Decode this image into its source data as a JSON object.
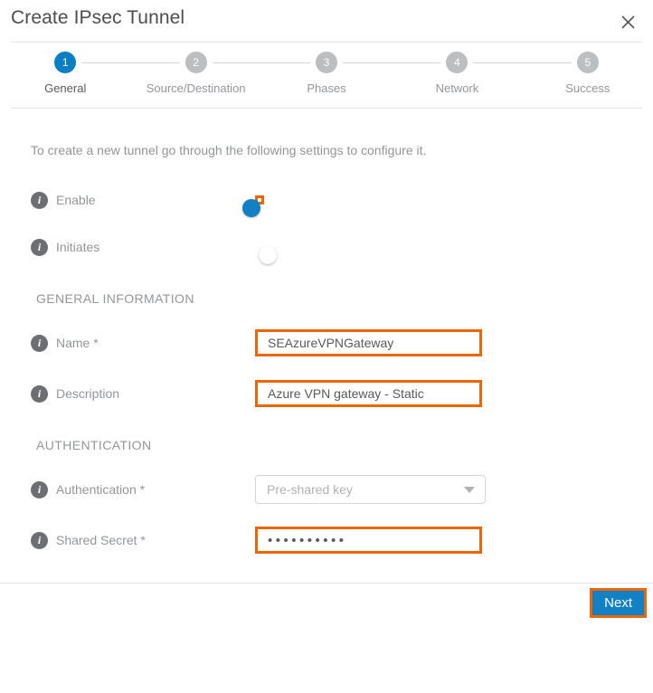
{
  "dialog": {
    "title": "Create IPsec Tunnel",
    "close_icon": "close-icon"
  },
  "stepper": {
    "steps": [
      {
        "number": "1",
        "label": "General",
        "state": "active"
      },
      {
        "number": "2",
        "label": "Source/Destination",
        "state": "inactive"
      },
      {
        "number": "3",
        "label": "Phases",
        "state": "inactive"
      },
      {
        "number": "4",
        "label": "Network",
        "state": "inactive"
      },
      {
        "number": "5",
        "label": "Success",
        "state": "inactive"
      }
    ]
  },
  "body": {
    "intro": "To create a new tunnel go through the following settings to configure it.",
    "toggles": [
      {
        "label": "Enable",
        "state": "on",
        "highlighted": true
      },
      {
        "label": "Initiates",
        "state": "off",
        "highlighted": false
      }
    ],
    "sections": [
      {
        "title": "GENERAL INFORMATION",
        "fields": [
          {
            "label": "Name *",
            "value": "SEAzureVPNGateway",
            "type": "text",
            "highlighted": true
          },
          {
            "label": "Description",
            "value": "Azure VPN gateway - Static",
            "type": "text",
            "highlighted": true
          }
        ]
      },
      {
        "title": "AUTHENTICATION",
        "fields": [
          {
            "label": "Authentication *",
            "value": "Pre-shared key",
            "type": "select",
            "highlighted": false
          },
          {
            "label": "Shared Secret *",
            "value": "••••••••••",
            "type": "password",
            "highlighted": true
          }
        ]
      }
    ]
  },
  "footer": {
    "next_label": "Next",
    "next_highlighted": true
  },
  "colors": {
    "accent_blue": "#1280c4",
    "highlight_orange": "#ec6608",
    "step_inactive_grey": "#bcbec0",
    "label_grey": "#939598",
    "text_grey": "#58595b"
  }
}
